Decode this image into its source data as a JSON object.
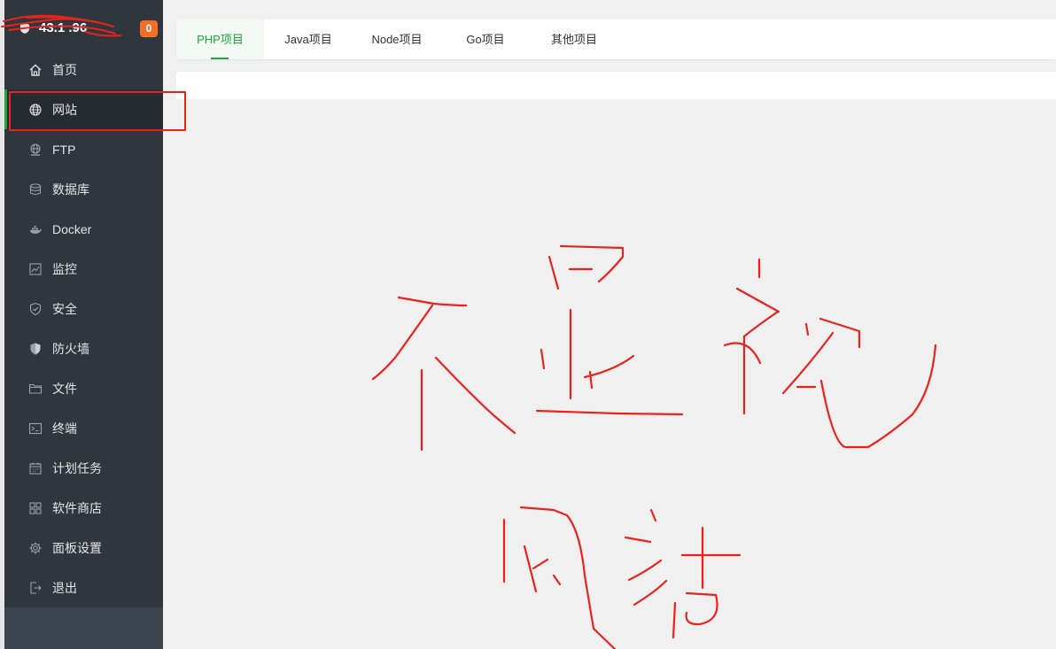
{
  "server": {
    "ip": "43.1 .96",
    "notice_count": "0"
  },
  "sidebar": {
    "items": [
      {
        "label": "首页",
        "icon": "home-icon"
      },
      {
        "label": "网站",
        "icon": "globe-icon",
        "active": true
      },
      {
        "label": "FTP",
        "icon": "ftp-icon"
      },
      {
        "label": "数据库",
        "icon": "database-icon"
      },
      {
        "label": "Docker",
        "icon": "docker-icon"
      },
      {
        "label": "监控",
        "icon": "monitor-icon"
      },
      {
        "label": "安全",
        "icon": "shield-check-icon"
      },
      {
        "label": "防火墙",
        "icon": "firewall-shield-icon"
      },
      {
        "label": "文件",
        "icon": "folder-icon"
      },
      {
        "label": "终端",
        "icon": "terminal-icon"
      },
      {
        "label": "计划任务",
        "icon": "calendar-icon"
      },
      {
        "label": "软件商店",
        "icon": "apps-grid-icon"
      },
      {
        "label": "面板设置",
        "icon": "gear-icon"
      },
      {
        "label": "退出",
        "icon": "logout-icon"
      }
    ]
  },
  "tabs": [
    {
      "label": "PHP项目",
      "active": true
    },
    {
      "label": "Java项目"
    },
    {
      "label": "Node项目"
    },
    {
      "label": "Go项目"
    },
    {
      "label": "其他项目"
    }
  ],
  "colors": {
    "accent": "#20a53a",
    "sidebar_bg": "#30363d",
    "annotation": "#e8231e",
    "badge": "#f0702a"
  }
}
